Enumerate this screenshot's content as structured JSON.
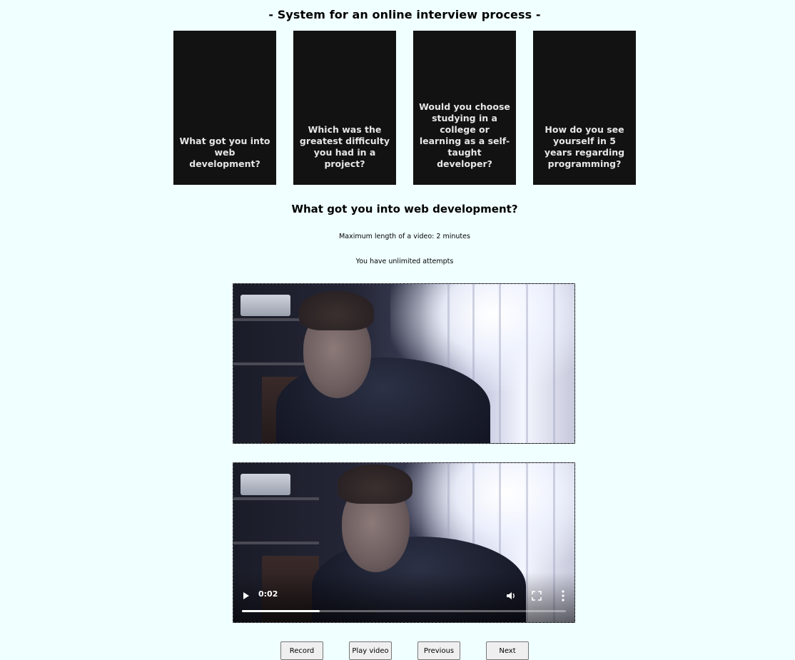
{
  "header": {
    "title": "- System for an online interview process -"
  },
  "questions": [
    {
      "text": "What got you into web development?"
    },
    {
      "text": "Which was the greatest difficulty you had in a project?"
    },
    {
      "text": "Would you choose studying in a college or learning as a self-taught developer?"
    },
    {
      "text": "How do you see yourself in 5 years regarding programming?"
    }
  ],
  "current_question": {
    "heading": "What got you into web development?",
    "max_length_note": "Maximum length of a video: 2 minutes",
    "attempts_note": "You have unlimited attempts"
  },
  "playback": {
    "current_time": "0:02",
    "progress_fraction": 0.24,
    "icons": [
      "play-icon",
      "volume-icon",
      "fullscreen-icon",
      "more-options-icon"
    ]
  },
  "controls": {
    "record_label": "Record",
    "play_label": "Play video",
    "previous_label": "Previous",
    "next_label": "Next"
  },
  "colors": {
    "page_background": "#F0FFFF",
    "card_background": "#121212",
    "card_text": "#E6E6E6"
  }
}
